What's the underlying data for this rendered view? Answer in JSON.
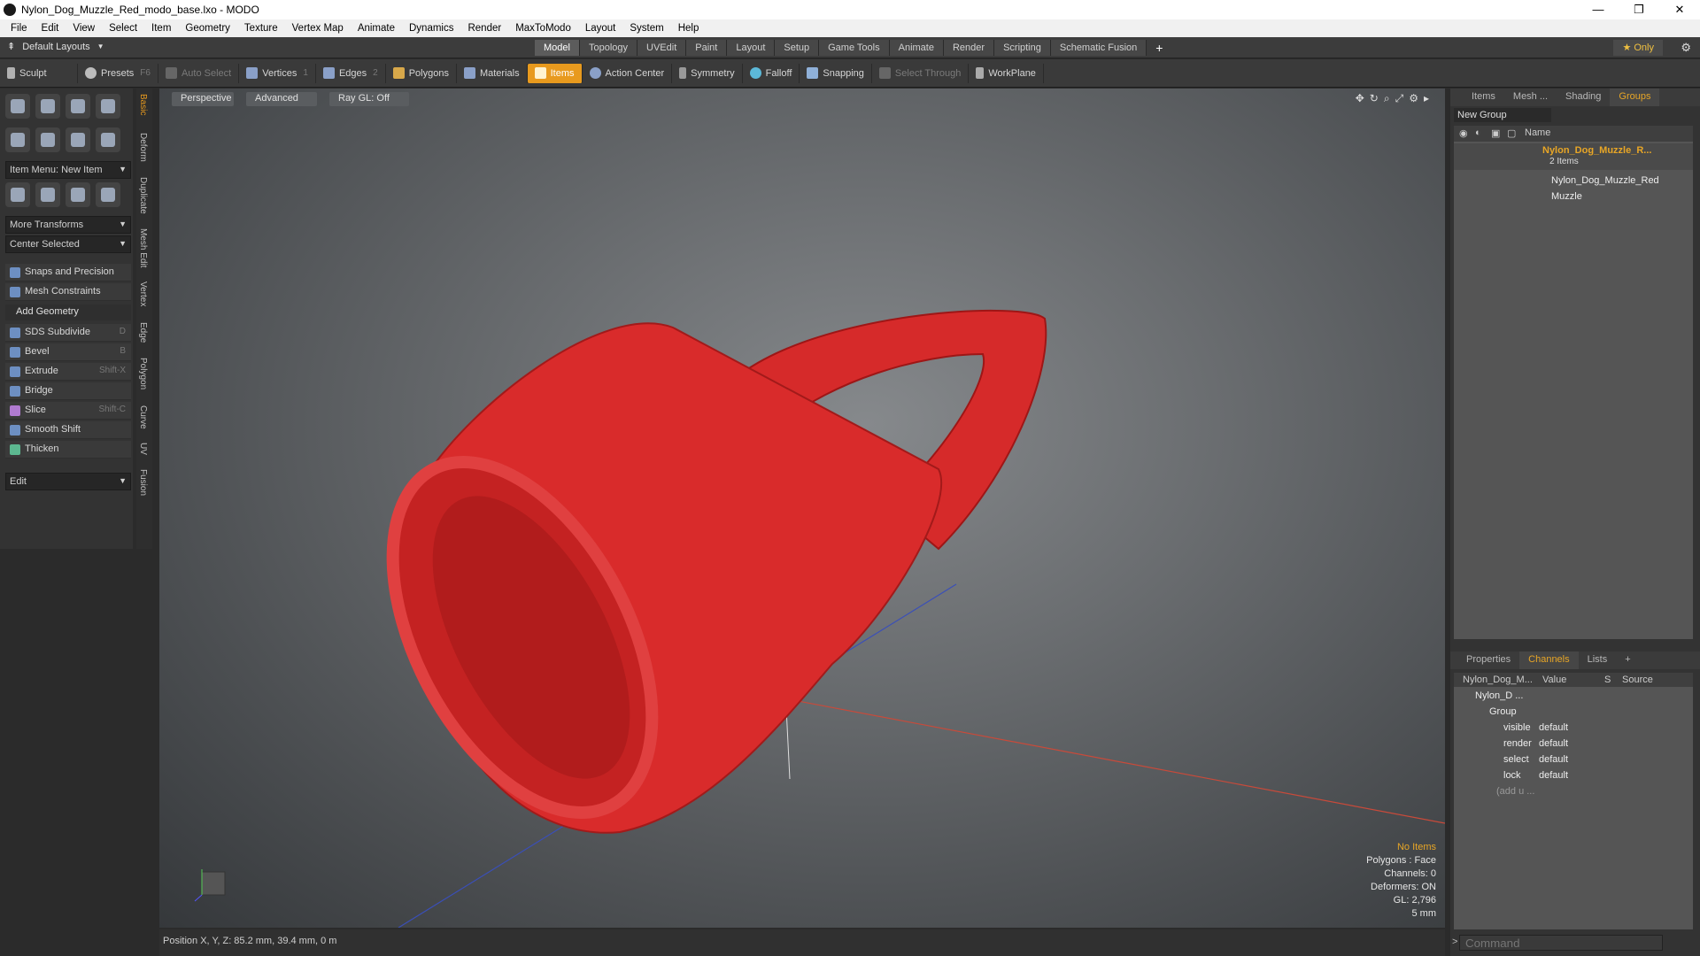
{
  "window": {
    "title": "Nylon_Dog_Muzzle_Red_modo_base.lxo - MODO",
    "controls": [
      "—",
      "❐",
      "✕"
    ]
  },
  "menu": [
    "File",
    "Edit",
    "View",
    "Select",
    "Item",
    "Geometry",
    "Texture",
    "Vertex Map",
    "Animate",
    "Dynamics",
    "Render",
    "MaxToModo",
    "Layout",
    "System",
    "Help"
  ],
  "layoutbar": {
    "layouts_label": "Default Layouts",
    "tabs": [
      "Model",
      "Topology",
      "UVEdit",
      "Paint",
      "Layout",
      "Setup",
      "Game Tools",
      "Animate",
      "Render",
      "Scripting",
      "Schematic Fusion"
    ],
    "active_tab": "Model",
    "add": "+",
    "only": "★  Only"
  },
  "toolbar": {
    "sculpt": "Sculpt",
    "presets": "Presets",
    "presets_key": "F6",
    "auto_select": "Auto Select",
    "vertices": "Vertices",
    "vertices_n": "1",
    "edges": "Edges",
    "edges_n": "2",
    "polygons": "Polygons",
    "materials": "Materials",
    "items": "Items",
    "action_center": "Action Center",
    "symmetry": "Symmetry",
    "falloff": "Falloff",
    "snapping": "Snapping",
    "select_through": "Select Through",
    "workplane": "WorkPlane"
  },
  "leftpanel": {
    "item_menu": "Item Menu: New Item",
    "more_transforms": "More Transforms",
    "center_selected": "Center Selected",
    "snaps": "Snaps and Precision",
    "mesh_constraints": "Mesh Constraints",
    "add_geometry": "Add Geometry",
    "tools": [
      {
        "label": "SDS Subdivide",
        "key": "D"
      },
      {
        "label": "Bevel",
        "key": "B"
      },
      {
        "label": "Extrude",
        "key": "Shift-X"
      },
      {
        "label": "Bridge",
        "key": ""
      },
      {
        "label": "Slice",
        "key": "Shift-C"
      },
      {
        "label": "Smooth Shift",
        "key": ""
      },
      {
        "label": "Thicken",
        "key": ""
      }
    ],
    "edit": "Edit",
    "vtabs": [
      "Basic",
      "Deform",
      "Duplicate",
      "Mesh Edit",
      "Vertex",
      "Edge",
      "Polygon",
      "Curve",
      "UV",
      "Fusion"
    ]
  },
  "viewport": {
    "tabs": [
      "Perspective",
      "Advanced",
      "Ray GL: Off"
    ],
    "info": {
      "items": "No Items",
      "polygons": "Polygons : Face",
      "channels": "Channels: 0",
      "deformers": "Deformers: ON",
      "gl": "GL: 2,796",
      "scale": "5 mm"
    },
    "muzzle_color": "#d92b2b"
  },
  "statusbar": {
    "position": "Position X, Y, Z:  85.2 mm, 39.4 mm, 0 m"
  },
  "rightpanel": {
    "tabs": [
      "Items",
      "Mesh ...",
      "Shading",
      "Groups"
    ],
    "active_tab": "Groups",
    "new_group": "New Group",
    "name_header": "Name",
    "group_name": "Nylon_Dog_Muzzle_R...",
    "group_count": "2 Items",
    "child1": "Nylon_Dog_Muzzle_Red",
    "child2": "Muzzle",
    "lower_tabs": [
      "Properties",
      "Channels",
      "Lists",
      "+"
    ],
    "lower_active": "Channels",
    "ch_headers": [
      "Nylon_Dog_M...",
      "Value",
      "S",
      "Source"
    ],
    "ch_rows": [
      {
        "name": "Nylon_D ...",
        "value": ""
      },
      {
        "name": "Group",
        "value": ""
      },
      {
        "name": "visible",
        "value": "default"
      },
      {
        "name": "render",
        "value": "default"
      },
      {
        "name": "select",
        "value": "default"
      },
      {
        "name": "lock",
        "value": "default"
      },
      {
        "name": "(add u ...",
        "value": ""
      }
    ],
    "command_placeholder": "Command"
  }
}
